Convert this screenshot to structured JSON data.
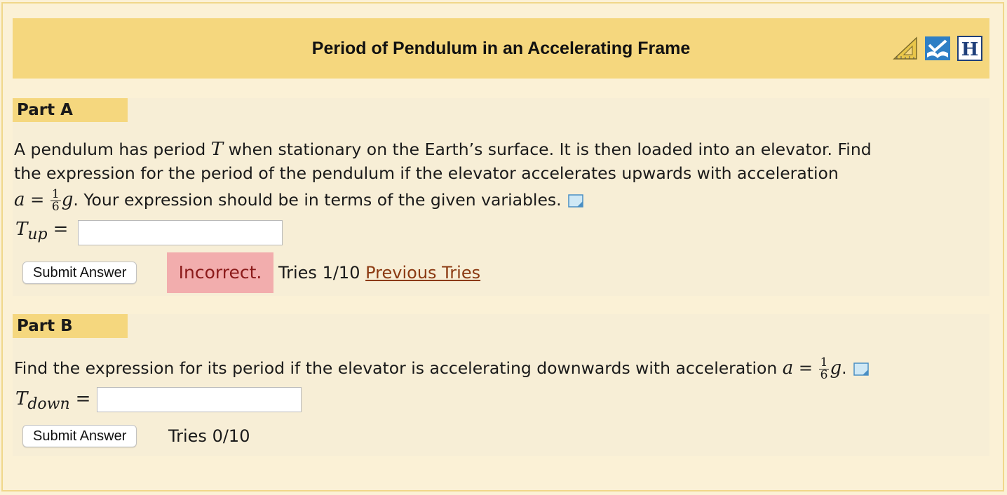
{
  "header": {
    "title": "Period of Pendulum in an Accelerating Frame",
    "icons": [
      "ruler-triangle-icon",
      "book-icon",
      "hint-h-icon"
    ]
  },
  "partA": {
    "label": "Part A",
    "text_line1_pre": "A pendulum has period ",
    "text_line1_var": "T",
    "text_line1_post": " when stationary on the Earth’s surface. It is then loaded into an elevator. Find",
    "text_line2": "the expression for the period of the pendulum if the elevator accelerates upwards with acceleration",
    "text_line3_var_a": "a",
    "text_line3_eq": " = ",
    "frac_num": "1",
    "frac_den": "6",
    "text_line3_var_g": "g",
    "text_line3_post": ". Your expression should be in terms of the given variables.",
    "answer_var": "T",
    "answer_sub": "up",
    "answer_eq": "=",
    "answer_value": "",
    "submit_label": "Submit Answer",
    "feedback": "Incorrect.",
    "tries": "Tries 1/10",
    "previous_tries": "Previous Tries"
  },
  "partB": {
    "label": "Part B",
    "text_pre": "Find the expression for its period if the elevator is accelerating downwards with acceleration ",
    "text_var_a": "a",
    "text_eq": " = ",
    "frac_num": "1",
    "frac_den": "6",
    "text_var_g": "g",
    "text_post": ".",
    "answer_var": "T",
    "answer_sub": "down",
    "answer_eq": "=",
    "answer_value": "",
    "submit_label": "Submit Answer",
    "tries": "Tries 0/10"
  },
  "colors": {
    "header_bg": "#f5d77e",
    "panel_bg": "#f7eed6",
    "incorrect_bg": "#f2adad",
    "incorrect_text": "#8b1a1a",
    "link": "#8b3a12"
  }
}
